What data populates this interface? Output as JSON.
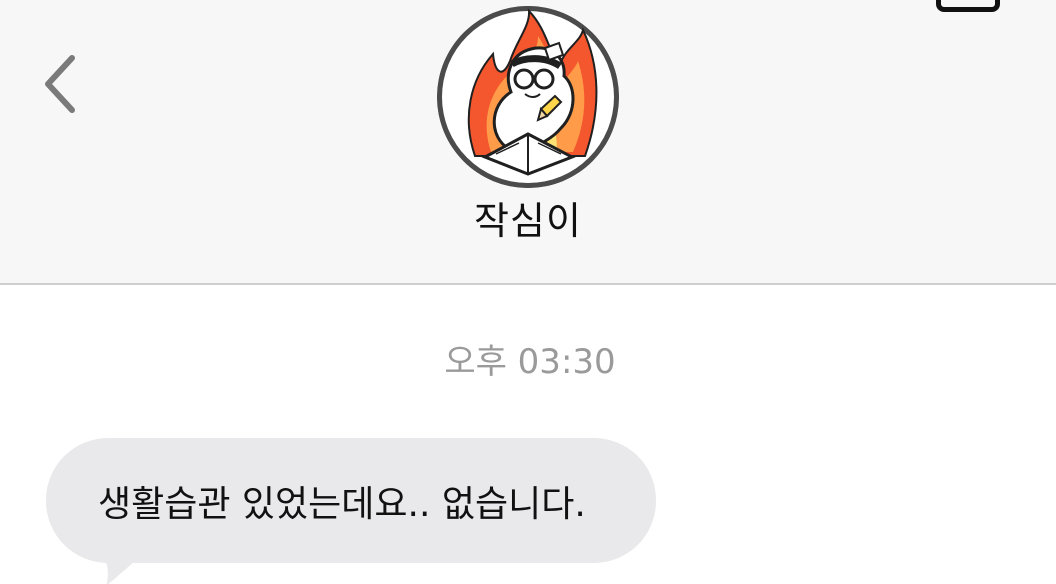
{
  "header": {
    "back_icon": "chevron-left-icon",
    "contact_name": "작심이",
    "avatar_icon": "profile-avatar-studying-character-on-fire"
  },
  "conversation": {
    "timestamp": "오후 03:30",
    "messages": [
      {
        "direction": "incoming",
        "text": "생활습관 있었는데요.. 없습니다."
      }
    ]
  },
  "colors": {
    "header_background": "#f7f7f7",
    "header_border": "#cfcfcf",
    "incoming_bubble": "#e9e9eb",
    "timestamp_text": "#9a9a9a",
    "primary_text": "#111111",
    "back_icon": "#7a7a7a"
  }
}
